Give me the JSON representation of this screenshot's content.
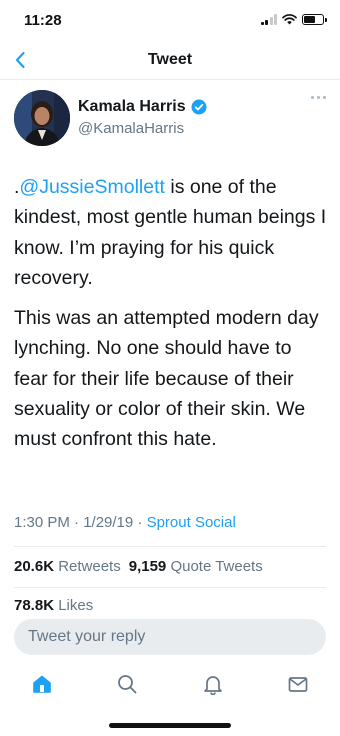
{
  "status_bar": {
    "time": "11:28"
  },
  "header": {
    "title": "Tweet",
    "back_icon": "chevron-left-icon"
  },
  "author": {
    "name": "Kamala Harris",
    "handle": "@KamalaHarris",
    "verified": true
  },
  "tweet": {
    "paragraph1": {
      "prefix": ".",
      "mention": "@JussieSmollett",
      "rest": " is one of the kindest, most gentle human beings I know. I’m praying for his quick recovery."
    },
    "paragraph2": "This was an attempted modern day lynching. No one should have to fear for their life because of their sexuality or color of their skin. We must confront this hate.",
    "time": "1:30 PM · 1/29/19 · ",
    "source": "Sprout Social"
  },
  "stats": {
    "retweets_count": "20.6K",
    "retweets_label": " Retweets",
    "quotes_count": "9,159",
    "quotes_label": " Quote Tweets",
    "likes_count": "78.8K",
    "likes_label": " Likes"
  },
  "reply": {
    "placeholder": "Tweet your reply"
  },
  "tabbar": {
    "items": [
      "home-icon",
      "search-icon",
      "bell-icon",
      "mail-icon"
    ],
    "active": "home-icon"
  },
  "colors": {
    "accent": "#1da1f2",
    "text": "#14171a",
    "secondary": "#657786",
    "reply_bg": "#e8ecef"
  }
}
